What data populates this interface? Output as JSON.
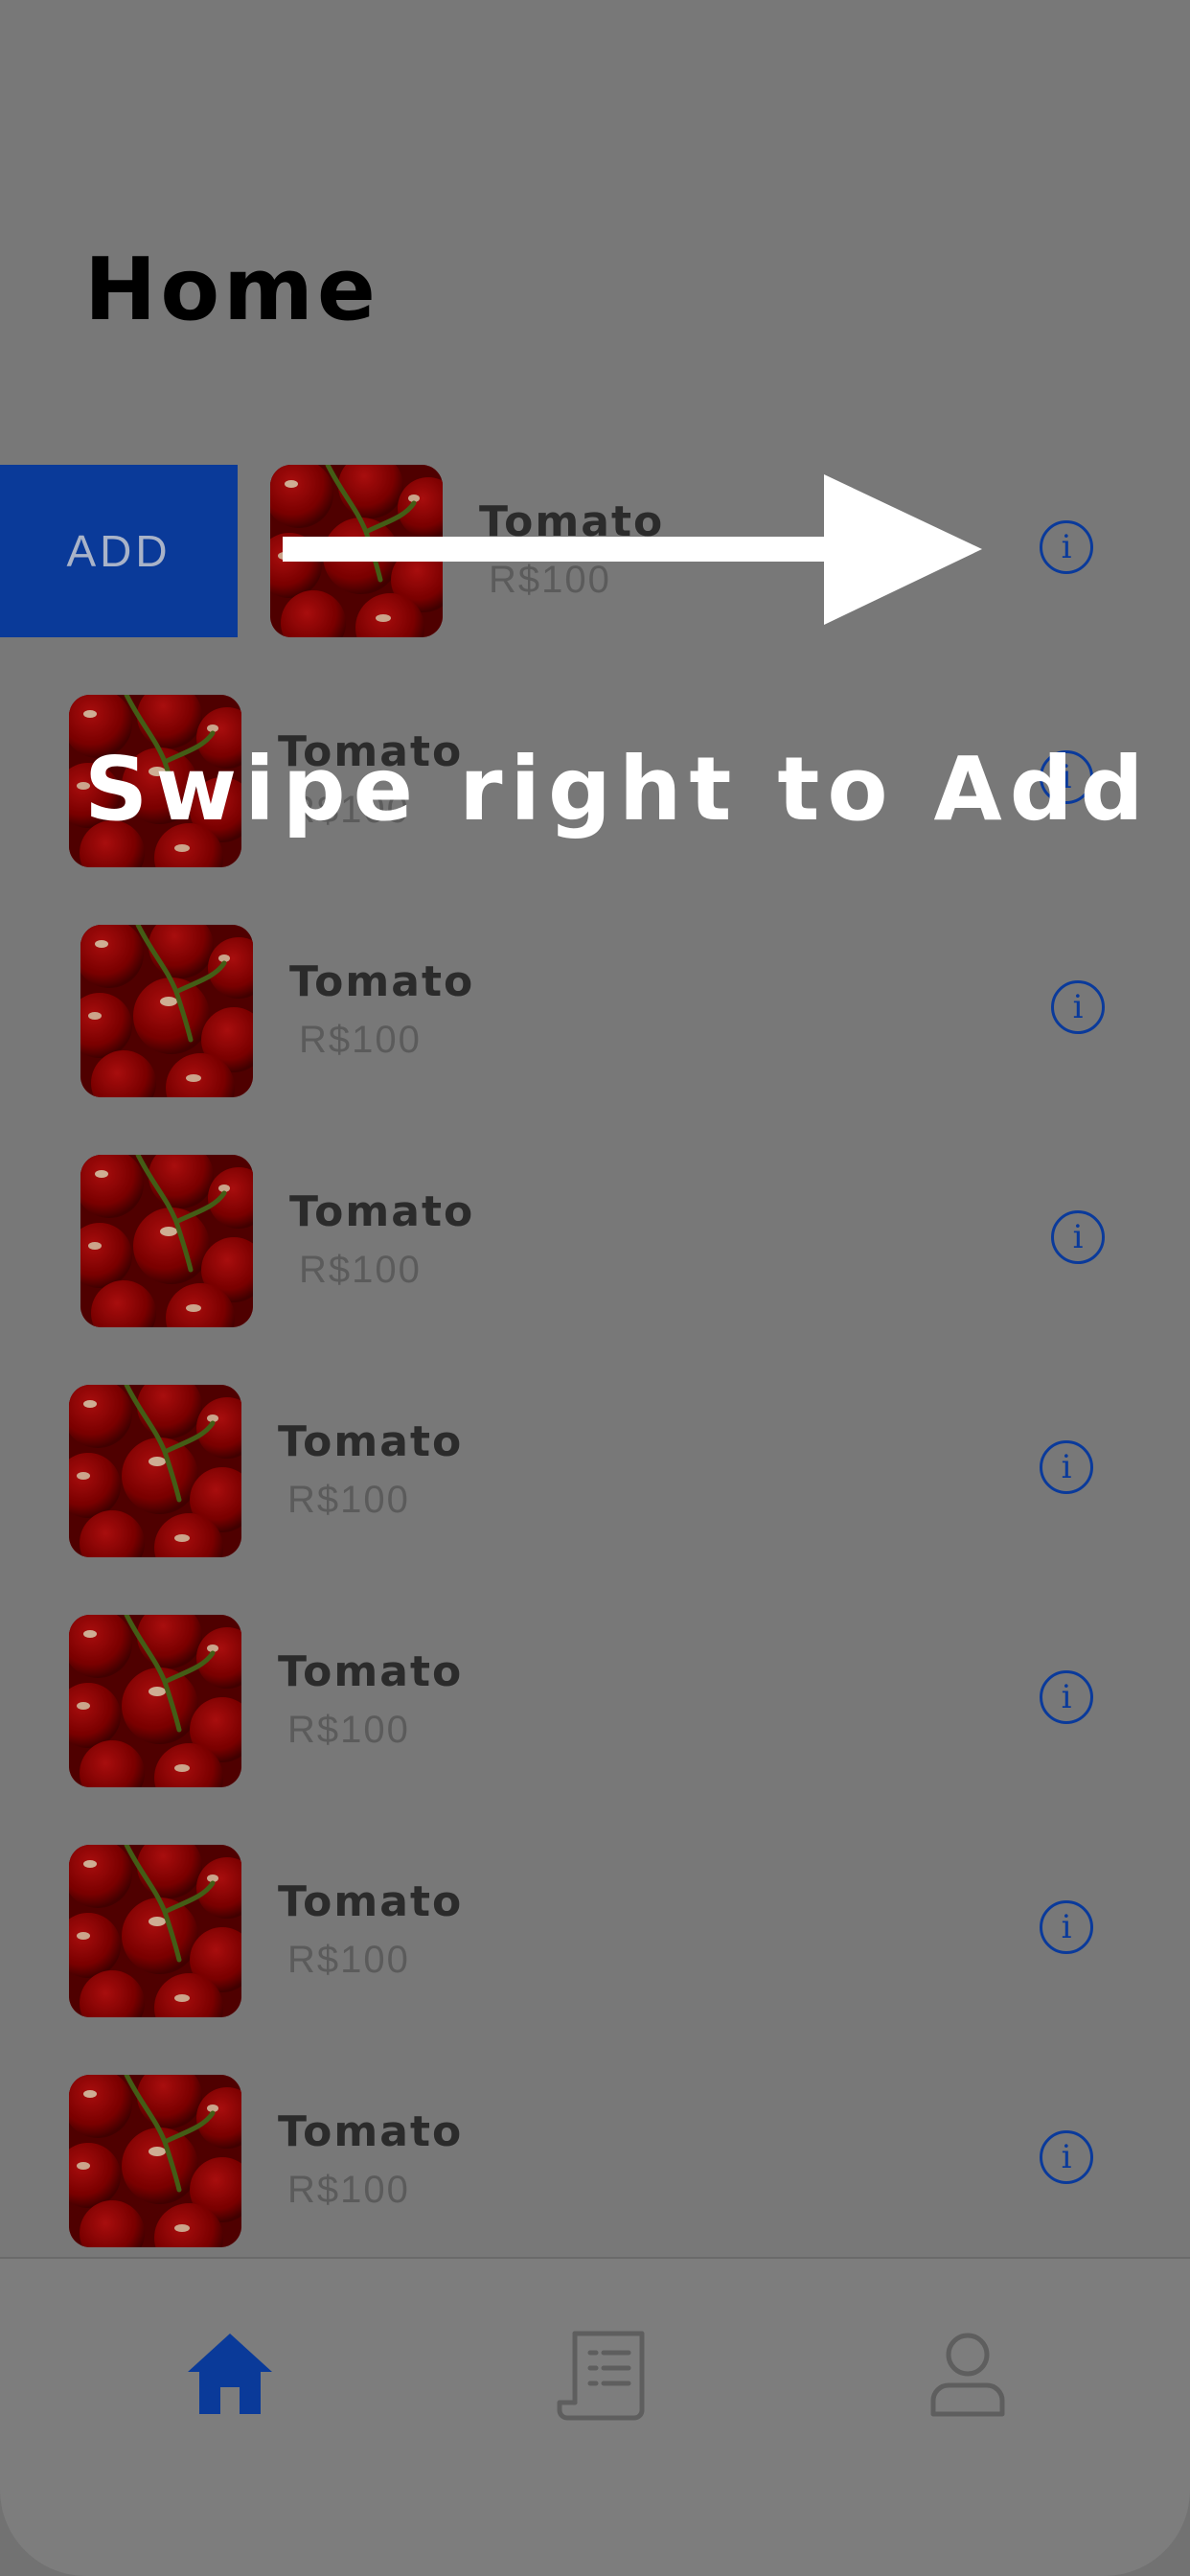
{
  "header": {
    "title": "Home"
  },
  "swipe_hint": {
    "text": "Swipe right to Add"
  },
  "swipe_action": {
    "label": "ADD"
  },
  "products": [
    {
      "name": "Tomato",
      "price": "R$100"
    },
    {
      "name": "Tomato",
      "price": "R$100"
    },
    {
      "name": "Tomato",
      "price": "R$100"
    },
    {
      "name": "Tomato",
      "price": "R$100"
    },
    {
      "name": "Tomato",
      "price": "R$100"
    },
    {
      "name": "Tomato",
      "price": "R$100"
    },
    {
      "name": "Tomato",
      "price": "R$100"
    },
    {
      "name": "Tomato",
      "price": "R$100"
    }
  ],
  "info_icon": {
    "glyph": "i"
  },
  "tabbar": {
    "tabs": [
      {
        "icon": "home-icon",
        "active": true
      },
      {
        "icon": "receipt-list-icon",
        "active": false
      },
      {
        "icon": "user-profile-icon",
        "active": false
      }
    ]
  },
  "colors": {
    "accent": "#0a3a99",
    "overlay_background": "#787878",
    "hint_text": "#ffffff"
  }
}
